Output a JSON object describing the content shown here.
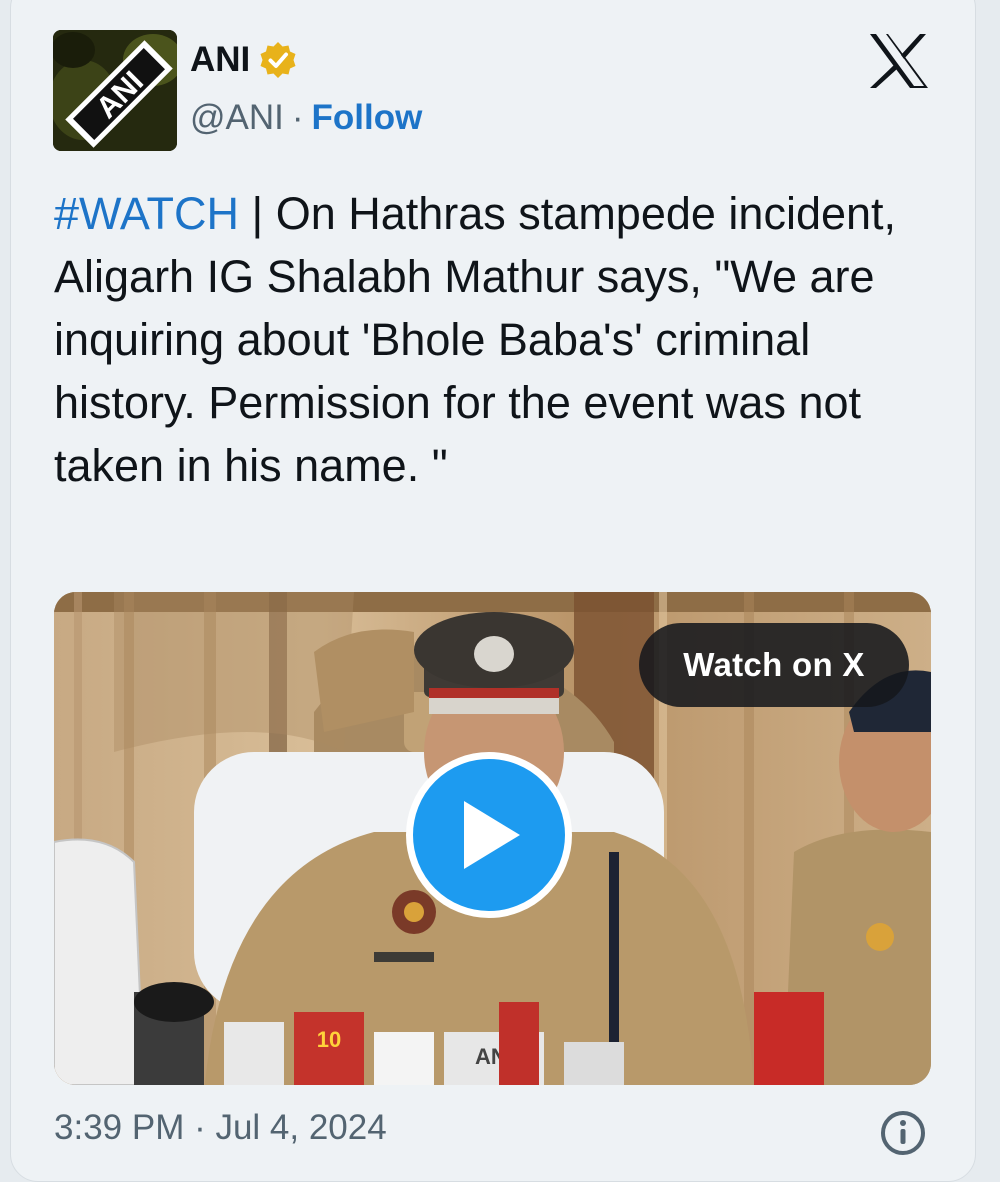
{
  "author": {
    "name": "ANI",
    "handle": "@ANI",
    "separator": "·",
    "follow_label": "Follow",
    "avatar_text": "ANI",
    "verified_icon": "verified-badge-icon"
  },
  "tweet": {
    "hashtag": "#WATCH",
    "body": " | On Hathras stampede incident, Aligarh IG Shalabh Mathur says, \"We are inquiring about 'Bhole Baba's' criminal history. Permission for the event was not taken in his name. \""
  },
  "media": {
    "watch_label": "Watch on X",
    "play_icon": "play-icon",
    "mic_label_1": "10",
    "mic_label_2": "ANI"
  },
  "footer": {
    "timestamp": "3:39 PM · Jul 4, 2024",
    "info_icon": "info-icon"
  },
  "colors": {
    "link": "#1d74c8",
    "play": "#1d9bf0",
    "verified": "#e8b21a"
  }
}
